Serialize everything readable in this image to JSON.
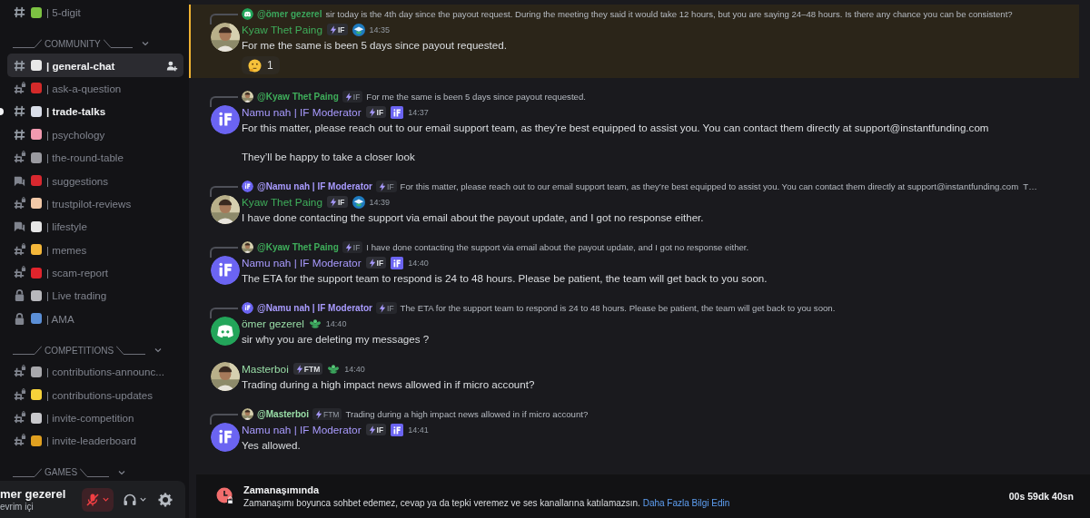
{
  "sidebar": {
    "items": [
      {
        "kind": "text-channel",
        "color": "#7cc242",
        "name": "| 5-digit",
        "selected": false,
        "unread": false
      },
      {
        "kind": "category",
        "name": "COMMUNITY"
      },
      {
        "kind": "text-channel",
        "color": "#e8e8e8",
        "name": "| general-chat",
        "selected": true,
        "unread": false
      },
      {
        "kind": "locked-text-channel",
        "color": "#d42a2a",
        "name": "| ask-a-question",
        "selected": false,
        "unread": false
      },
      {
        "kind": "text-channel",
        "color": "#d9dde8",
        "name": "| trade-talks",
        "selected": false,
        "unread": true
      },
      {
        "kind": "text-channel",
        "color": "#f29ab0",
        "name": "| psychology",
        "selected": false,
        "unread": false
      },
      {
        "kind": "locked-text-channel",
        "color": "#9a9aa0",
        "name": "| the-round-table",
        "selected": false,
        "unread": false
      },
      {
        "kind": "forum-channel",
        "color": "#d8282f",
        "name": "| suggestions",
        "selected": false,
        "unread": false
      },
      {
        "kind": "locked-text-channel",
        "color": "#f2c9a8",
        "name": "| trustpilot-reviews",
        "selected": false,
        "unread": false
      },
      {
        "kind": "forum-channel",
        "color": "#e6e6e6",
        "name": "| lifestyle",
        "selected": false,
        "unread": false
      },
      {
        "kind": "locked-text-channel",
        "color": "#f4b73a",
        "name": "| memes",
        "selected": false,
        "unread": false
      },
      {
        "kind": "locked-text-channel",
        "color": "#e0242c",
        "name": "| scam-report",
        "selected": false,
        "unread": false
      },
      {
        "kind": "locked-channel",
        "color": "#b8b8bc",
        "name": "| Live trading",
        "selected": false,
        "unread": false
      },
      {
        "kind": "locked-channel",
        "color": "#5b8fd6",
        "name": "| AMA",
        "selected": false,
        "unread": false
      },
      {
        "kind": "category",
        "name": "COMPETITIONS"
      },
      {
        "kind": "locked-text-channel",
        "color": "#a8a8ac",
        "name": "| contributions-announc...",
        "selected": false,
        "unread": false
      },
      {
        "kind": "locked-text-channel",
        "color": "#f6d23a",
        "name": "| contributions-updates",
        "selected": false,
        "unread": false
      },
      {
        "kind": "locked-text-channel",
        "color": "#c8c8cc",
        "name": "| invite-competition",
        "selected": false,
        "unread": false
      },
      {
        "kind": "locked-text-channel",
        "color": "#e0a020",
        "name": "| invite-leaderboard",
        "selected": false,
        "unread": false
      },
      {
        "kind": "category",
        "name": "GAMES"
      }
    ]
  },
  "user_panel": {
    "name": "mer gezerel",
    "status": "evrim içi",
    "muted": true
  },
  "messages": [
    {
      "highlighted": true,
      "reply": {
        "author": {
          "kind": "discord",
          "name": "@ömer gezerel",
          "color": "#3ba55c"
        },
        "text": "sir today is the 4th day since the payout request. During the meeting they said it would take 12 hours, but you are saying 24–48 hours. Is there any chance you can be consistent?"
      },
      "author": {
        "name": "Kyaw Thet Paing",
        "color": "#3fae5b"
      },
      "tag": "IF",
      "badges": [
        {
          "kind": "cap"
        }
      ],
      "time": "14:35",
      "paragraphs": [
        "For me the same is been 5 days since payout requested."
      ],
      "reactions": [
        {
          "count": "1"
        }
      ]
    },
    {
      "highlighted": false,
      "reply": {
        "author": {
          "name": "@Kyaw Thet Paing",
          "color": "#3fae5b"
        },
        "tag": "IF",
        "text": "For me the same is been 5 days since payout requested."
      },
      "author": {
        "kind": "logo",
        "name": "Namu nah | IF Moderator",
        "color": "#a99bff"
      },
      "tag": "IF",
      "badges": [
        {
          "kind": "logo"
        }
      ],
      "time": "14:37",
      "paragraphs": [
        "For this matter, please reach out to our email support team, as they’re best equipped to assist you. You can contact them directly at support@instantfunding.com",
        "They’ll be happy to take a closer look"
      ]
    },
    {
      "highlighted": false,
      "reply": {
        "author": {
          "kind": "logo",
          "name": "@Namu nah | IF Moderator",
          "color": "#a99bff"
        },
        "tag": "IF",
        "text": "For this matter, please reach out to our email support team, as they’re best equipped to assist you. You can contact them directly at support@instantfunding.com  T…"
      },
      "author": {
        "name": "Kyaw Thet Paing",
        "color": "#3fae5b"
      },
      "tag": "IF",
      "badges": [
        {
          "kind": "cap"
        }
      ],
      "time": "14:39",
      "paragraphs": [
        "I have done contacting the support via email about the payout update, and I got no response either."
      ]
    },
    {
      "highlighted": false,
      "reply": {
        "author": {
          "name": "@Kyaw Thet Paing",
          "color": "#3fae5b"
        },
        "tag": "IF",
        "text": "I have done contacting the support via email about the payout update, and I got no response either."
      },
      "author": {
        "kind": "logo",
        "name": "Namu nah | IF Moderator",
        "color": "#a99bff"
      },
      "tag": "IF",
      "badges": [
        {
          "kind": "logo"
        }
      ],
      "time": "14:40",
      "paragraphs": [
        "The ETA for the support team to respond is 24 to 48 hours. Please be patient, the team will get back to you soon."
      ]
    },
    {
      "highlighted": false,
      "reply": {
        "author": {
          "kind": "logo",
          "name": "@Namu nah | IF Moderator",
          "color": "#a99bff"
        },
        "tag": "IF",
        "text": "The ETA for the support team to respond is 24 to 48 hours. Please be patient, the team will get back to you soon."
      },
      "author": {
        "kind": "discord",
        "name": "ömer gezerel",
        "color": "#9adfa8"
      },
      "badges": [
        {
          "kind": "sprout"
        }
      ],
      "time": "14:40",
      "paragraphs": [
        "sir why you are deleting my messages ?"
      ]
    },
    {
      "highlighted": false,
      "author": {
        "name": "Masterboi",
        "color": "#9adfa8"
      },
      "tag": "FTM",
      "badges": [
        {
          "kind": "sprout"
        }
      ],
      "time": "14:40",
      "paragraphs": [
        "Trading during a high impact news allowed in if micro account?"
      ]
    },
    {
      "highlighted": false,
      "reply": {
        "author": {
          "name": "@Masterboi",
          "color": "#9adfa8"
        },
        "tag": "FTM",
        "text": "Trading during a high impact news allowed in if micro account?"
      },
      "author": {
        "kind": "logo",
        "name": "Namu nah | IF Moderator",
        "color": "#a99bff"
      },
      "tag": "IF",
      "badges": [
        {
          "kind": "logo"
        }
      ],
      "time": "14:41",
      "paragraphs": [
        "Yes allowed."
      ]
    }
  ],
  "timeout_bar": {
    "title": "Zamanaşımında",
    "text": "Zamanaşımı boyunca sohbet edemez, cevap ya da tepki veremez ve ses kanallarına katılamazsın.",
    "link": "Daha Fazla Bilgi Edin",
    "countdown": "00s 59dk 40sn"
  }
}
